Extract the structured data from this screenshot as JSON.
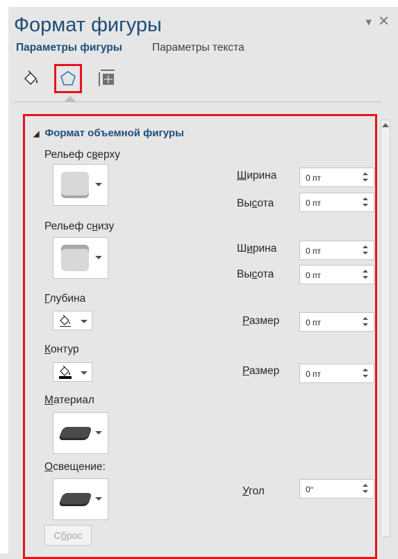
{
  "pane": {
    "title": "Формат фигуры",
    "tabs": [
      {
        "label": "Параметры фигуры",
        "active": true
      },
      {
        "label": "Параметры текста",
        "active": false
      }
    ],
    "icons": [
      "fill-line-icon",
      "effects-icon",
      "size-properties-icon"
    ]
  },
  "section": {
    "title": "Формат объемной фигуры",
    "bevel_top": {
      "label_pre": "Рельеф с",
      "label_ul": "в",
      "label_post": "ерху",
      "width_label_ul": "Ш",
      "width_label_rest": "ирина",
      "width_value": "0 пт",
      "height_label_pre": "Вы",
      "height_label_ul": "с",
      "height_label_post": "ота",
      "height_value": "0 пт"
    },
    "bevel_bottom": {
      "label_pre": "Рельеф с",
      "label_ul": "н",
      "label_post": "изу",
      "width_label_pre": "Ш",
      "width_label_ul": "и",
      "width_label_post": "рина",
      "width_value": "0 пт",
      "height_label_pre": "Вы",
      "height_label_ul": "с",
      "height_label_post": "ота",
      "height_value": "0 пт"
    },
    "depth": {
      "label_ul": "Г",
      "label_rest": "лубина",
      "size_label_ul": "Р",
      "size_label_rest": "азмер",
      "size_value": "0 пт"
    },
    "contour": {
      "label_ul": "К",
      "label_rest": "онтур",
      "size_label_ul": "Р",
      "size_label_rest": "азмер",
      "size_value": "0 пт"
    },
    "material": {
      "label_ul": "М",
      "label_rest": "атериал"
    },
    "lighting": {
      "label_ul": "О",
      "label_rest": "свещение:",
      "angle_label_ul": "У",
      "angle_label_rest": "гол",
      "angle_value": "0°"
    },
    "reset_pre": "С",
    "reset_ul": "б",
    "reset_post": "рос"
  },
  "colors": {
    "accent": "#1e4e79",
    "highlight": "#e4141d",
    "background": "#e6e6e6"
  }
}
